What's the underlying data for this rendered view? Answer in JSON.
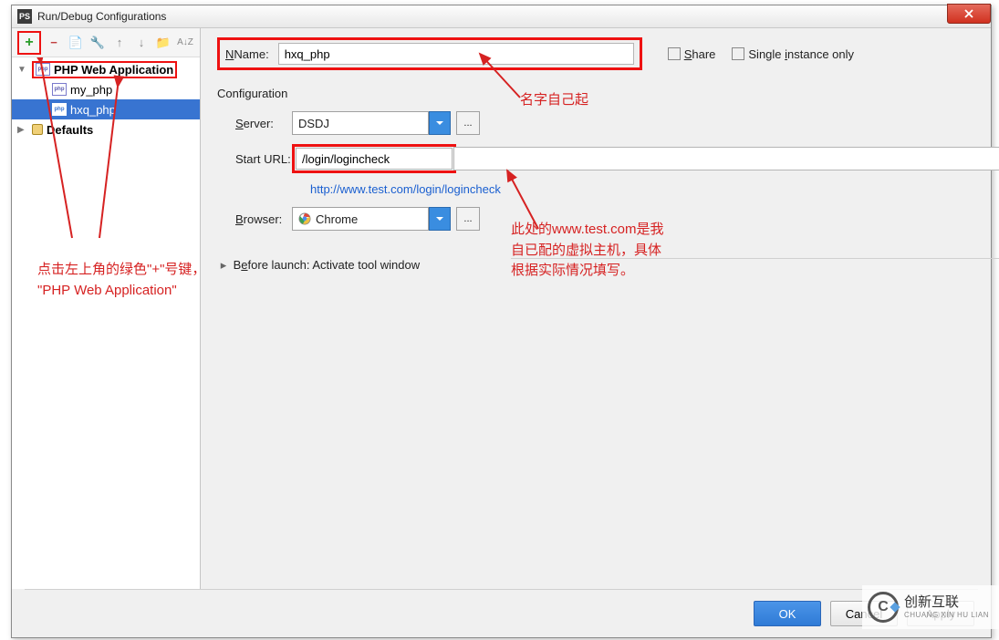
{
  "window": {
    "title": "Run/Debug Configurations"
  },
  "tree": {
    "root": "PHP Web Application",
    "items": [
      "my_php",
      "hxq_php"
    ],
    "defaults": "Defaults"
  },
  "form": {
    "name_label": "Name:",
    "name_value": "hxq_php",
    "share": "Share",
    "single": "Single instance only",
    "config_section": "Configuration",
    "server_label": "Server:",
    "server_value": "DSDJ",
    "url_label": "Start URL:",
    "url_value": "/login/logincheck",
    "url_link": "http://www.test.com/login/logincheck",
    "browser_label": "Browser:",
    "browser_value": "Chrome",
    "before_launch": "Before launch: Activate tool window"
  },
  "buttons": {
    "ok": "OK",
    "cancel": "Cancel",
    "apply": "Apply"
  },
  "annotations": {
    "name_note": "名字自己起",
    "url_note": "此处的www.test.com是我\n自已配的虚拟主机，具体\n根据实际情况填写。",
    "left_note": "点击左上角的绿色\"+\"号键，新建一个\n\"PHP Web Application\""
  },
  "watermark": {
    "big": "创新互联",
    "sub": "CHUANG XIN HU LIAN"
  }
}
